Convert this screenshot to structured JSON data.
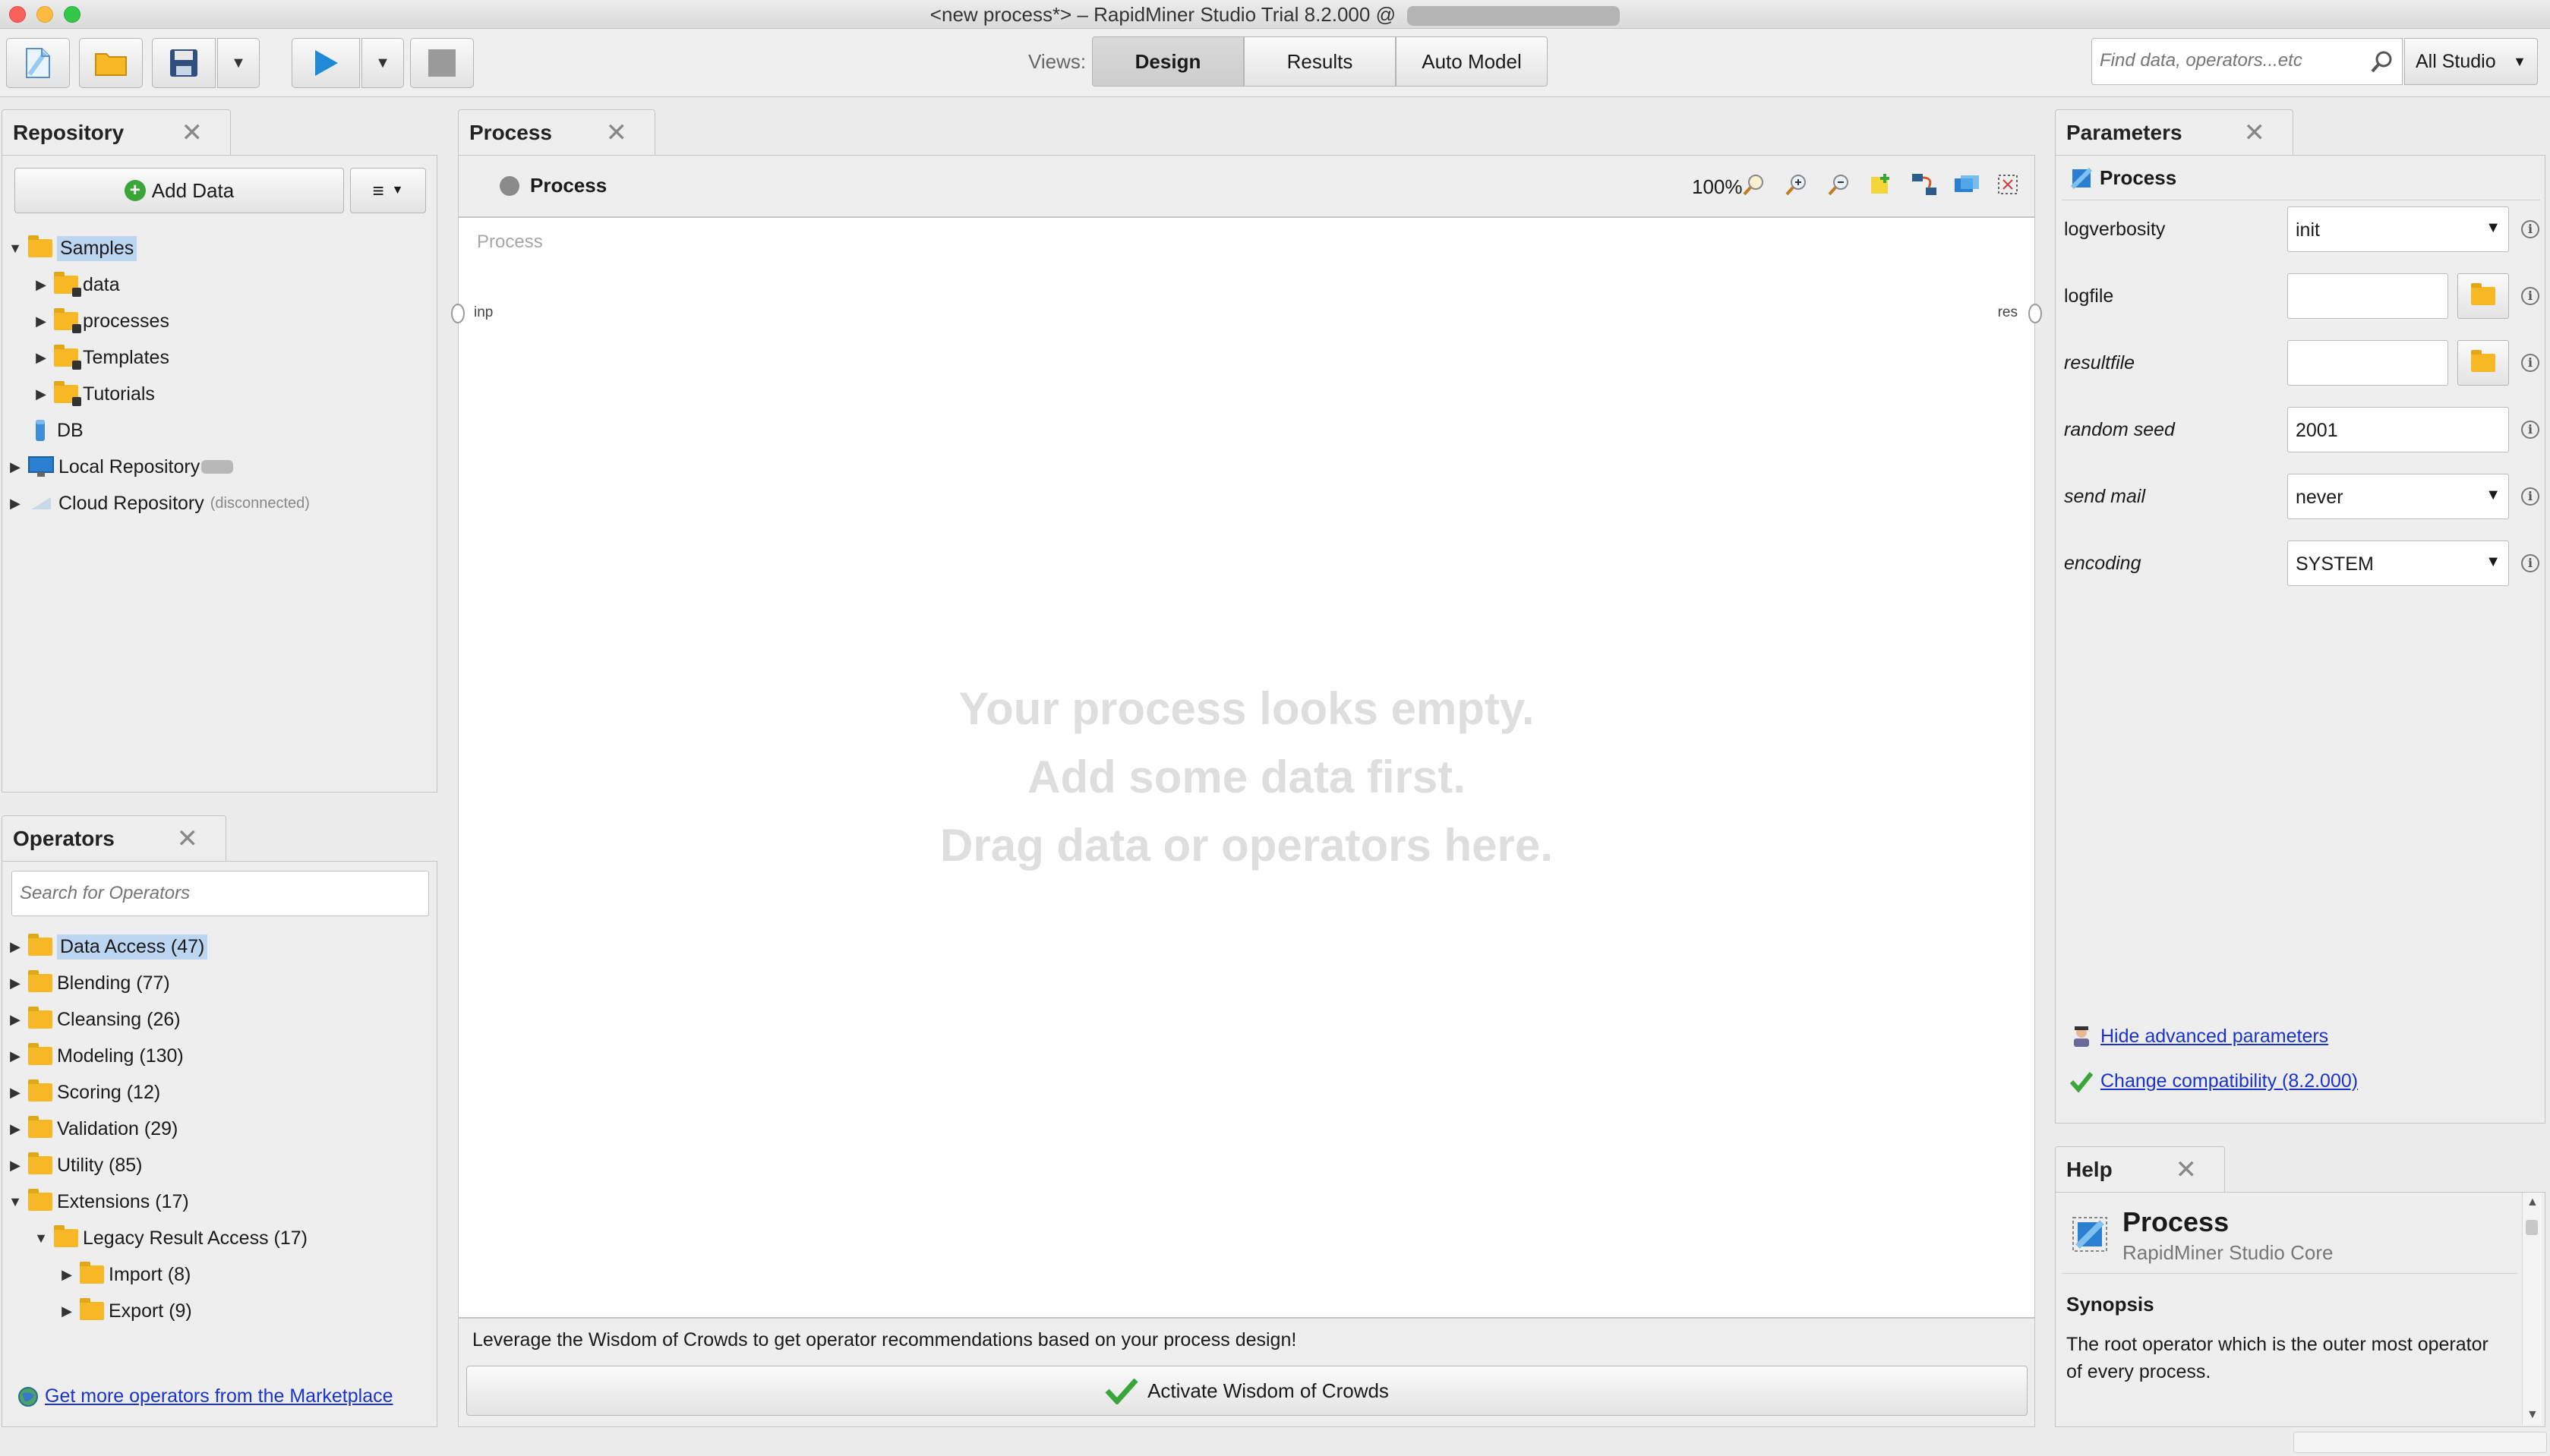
{
  "window": {
    "title": "<new process*> – RapidMiner Studio Trial 8.2.000 @"
  },
  "toolbar": {
    "views_label": "Views:",
    "views": [
      "Design",
      "Results",
      "Auto Model"
    ],
    "active_view": "Design",
    "search_placeholder": "Find data, operators...etc",
    "scope_select": "All Studio"
  },
  "repository": {
    "tab_label": "Repository",
    "add_data_label": "Add Data",
    "menu_label": "≡",
    "items": [
      {
        "label": "Samples",
        "selected": true,
        "expanded": true
      },
      {
        "label": "data"
      },
      {
        "label": "processes"
      },
      {
        "label": "Templates"
      },
      {
        "label": "Tutorials"
      },
      {
        "label": "DB"
      },
      {
        "label": "Local Repository"
      },
      {
        "label": "Cloud Repository",
        "note": "(disconnected)"
      }
    ]
  },
  "operators": {
    "tab_label": "Operators",
    "search_placeholder": "Search for Operators",
    "items": [
      {
        "label": "Data Access (47)",
        "selected": true
      },
      {
        "label": "Blending (77)"
      },
      {
        "label": "Cleansing (26)"
      },
      {
        "label": "Modeling (130)"
      },
      {
        "label": "Scoring (12)"
      },
      {
        "label": "Validation (29)"
      },
      {
        "label": "Utility (85)"
      },
      {
        "label": "Extensions (17)",
        "expanded": true
      },
      {
        "label": "Legacy Result Access (17)",
        "expanded": true
      },
      {
        "label": "Import (8)"
      },
      {
        "label": "Export (9)"
      }
    ],
    "marketplace_link": "Get more operators from the Marketplace"
  },
  "process": {
    "tab_label": "Process",
    "breadcrumb": "Process",
    "zoom": "100%",
    "canvas_label": "Process",
    "input_port": "inp",
    "result_port": "res",
    "empty_lines": [
      "Your process looks empty.",
      "Add some data first.",
      "Drag data or operators here."
    ],
    "wisdom_text": "Leverage the Wisdom of Crowds to get operator recommendations based on your process design!",
    "wisdom_button": "Activate Wisdom of Crowds"
  },
  "parameters": {
    "tab_label": "Parameters",
    "operator_name": "Process",
    "rows": [
      {
        "label": "logverbosity",
        "value": "init",
        "type": "select"
      },
      {
        "label": "logfile",
        "value": "",
        "type": "file"
      },
      {
        "label": "resultfile",
        "value": "",
        "type": "file"
      },
      {
        "label": "random seed",
        "value": "2001",
        "type": "text"
      },
      {
        "label": "send mail",
        "value": "never",
        "type": "select"
      },
      {
        "label": "encoding",
        "value": "SYSTEM",
        "type": "select"
      }
    ],
    "hide_advanced_link": "Hide advanced parameters",
    "compat_link": "Change compatibility (8.2.000)"
  },
  "help": {
    "tab_label": "Help",
    "title": "Process",
    "subtitle": "RapidMiner Studio Core",
    "synopsis_heading": "Synopsis",
    "synopsis_text": "The root operator which is the outer most operator of every process."
  },
  "colors": {
    "accent_blue": "#1f8ad8",
    "folder_yellow": "#f6b925",
    "selection": "#bcd6f2",
    "link": "#1a33cc"
  }
}
